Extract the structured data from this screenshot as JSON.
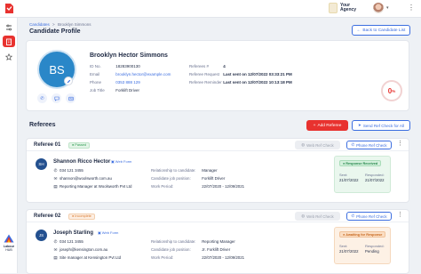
{
  "topbar": {
    "agency_line1": "Your",
    "agency_line2": "Agency"
  },
  "breadcrumb": {
    "root": "Candidates",
    "separator": ">",
    "current": "Brooklyn Simmons"
  },
  "page_title": "Candidate Profile",
  "back_button": "Back to Candidate List",
  "candidate": {
    "initials": "BS",
    "name": "Brooklyn Hector Simmons",
    "fields": [
      {
        "label": "ID No.",
        "value": "18283900130"
      },
      {
        "label": "Email",
        "value": "brooklyn.hector@example.com"
      },
      {
        "label": "Phone",
        "value": "0353 888 129"
      },
      {
        "label": "Job Title",
        "value": "Forklift Driver"
      }
    ],
    "ref_fields": [
      {
        "label": "Referees #",
        "value": "4"
      },
      {
        "label": "Referee Request",
        "value": "Last sent on 12/07/2022 03:33:21 PM"
      },
      {
        "label": "Referee Reminder",
        "value": "Last sent on 12/07/2022 10:13:18 PM"
      }
    ],
    "progress_value": "0",
    "progress_unit": "%"
  },
  "referees_section": {
    "title": "Referees",
    "add_button": "Add Referee",
    "send_all_button": "Send Ref Check for All"
  },
  "referees": [
    {
      "title": "Referee 01",
      "badge": "Passed",
      "web_ref": "Web Ref Check",
      "phone_ref": "Phone Ref Check",
      "initials": "SH",
      "name": "Shannon Ricco Hector",
      "form_type": "Web Form",
      "phone": "034 121 3455",
      "email": "shannon@woolsworth.com.au",
      "position": "Reporting Manager at Woolsworth Pvt Ltd",
      "relationship_label": "Relationship to candidate:",
      "relationship": "Manager",
      "cand_position_label": "Candidate job position:",
      "cand_position": "Forklift Driver",
      "work_period_label": "Work Period:",
      "work_period": "22/07/2020 - 12/09/2021",
      "status": "Response Received",
      "status_color": "#2f9b52",
      "sent_label": "Sent:",
      "sent": "21/07/2022",
      "responded_label": "Responded:",
      "responded": "21/07/2022"
    },
    {
      "title": "Referee 02",
      "badge": "Incomplete",
      "web_ref": "Web Ref Check",
      "phone_ref": "Phone Ref Check",
      "initials": "JS",
      "name": "Joseph Starling",
      "form_type": "Web Form",
      "phone": "034 121 3455",
      "email": "joseph@kensington.com.au",
      "position": "Site manager at Kensington Pvt Ltd",
      "relationship_label": "Relationship to candidate:",
      "relationship": "Reporting Manager",
      "cand_position_label": "Candidate job position:",
      "cand_position": "Jr. Forklift Driver",
      "work_period_label": "Work Period:",
      "work_period": "22/07/2020 - 12/09/2021",
      "status": "Awaiting for Response",
      "status_color": "#d9792c",
      "sent_label": "Sent:",
      "sent": "21/07/2022",
      "responded_label": "Responded:",
      "responded": "Pending"
    }
  ],
  "sidebar": {
    "items": [
      {
        "icon": "tune-icon"
      },
      {
        "icon": "building-icon"
      },
      {
        "icon": "star-icon"
      }
    ],
    "brand_line1": "Labour",
    "brand_line2": "HUB"
  },
  "colors": {
    "accent": "#e8322f",
    "primary": "#3c6ee0",
    "avatar": "#2a87c8"
  }
}
